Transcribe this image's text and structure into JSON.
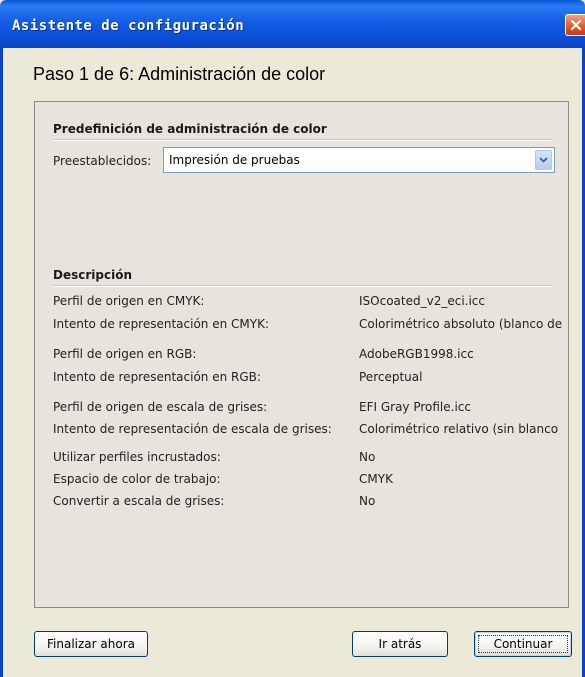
{
  "window": {
    "title": "Asistente de configuración",
    "step_title": "Paso 1 de 6: Administración de color"
  },
  "preset_section": {
    "header": "Predefinición de administración de color",
    "label": "Preestablecidos:",
    "selected": "Impresión de pruebas"
  },
  "description": {
    "header": "Descripción",
    "rows": [
      {
        "label": "Perfil de origen en CMYK:",
        "value": "ISOcoated_v2_eci.icc"
      },
      {
        "label": "Intento de representación en CMYK:",
        "value": "Colorimétrico absoluto (blanco de"
      },
      {
        "label": "Perfil de origen en RGB:",
        "value": "AdobeRGB1998.icc"
      },
      {
        "label": "Intento de representación en RGB:",
        "value": "Perceptual"
      },
      {
        "label": "Perfil de origen de escala de grises:",
        "value": "EFI Gray Profile.icc"
      },
      {
        "label": "Intento de representación de escala de grises:",
        "value": "Colorimétrico relativo (sin blanco"
      },
      {
        "label": "Utilizar perfiles incrustados:",
        "value": "No"
      },
      {
        "label": "Espacio de color de trabajo:",
        "value": "CMYK"
      },
      {
        "label": "Convertir a escala de grises:",
        "value": "No"
      }
    ]
  },
  "buttons": {
    "finish_now": "Finalizar ahora",
    "back": "Ir atrás",
    "continue": "Continuar"
  },
  "colors": {
    "titlebar": "#0a4fd7",
    "close": "#e25a2e",
    "dialog_bg": "#ece9d8"
  }
}
